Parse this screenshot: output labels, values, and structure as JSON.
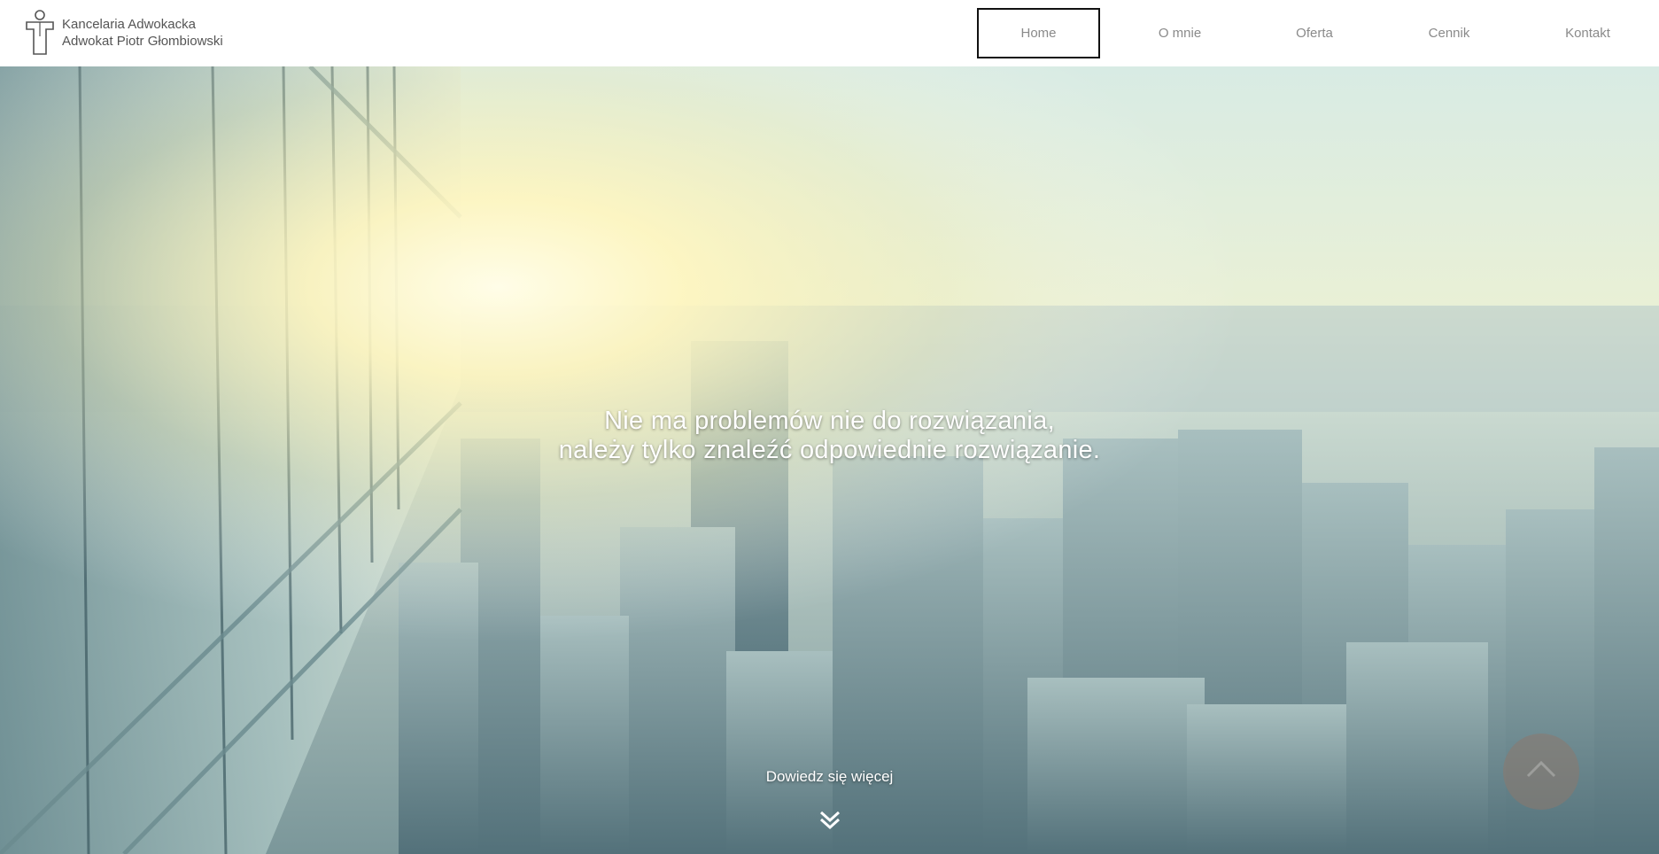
{
  "header": {
    "logo_line1": "Kancelaria Adwokacka",
    "logo_line2": "Adwokat Piotr Głombiowski",
    "logo_icon": "lawyer-figure-icon"
  },
  "nav": {
    "items": [
      {
        "label": "Home",
        "active": true
      },
      {
        "label": "O mnie",
        "active": false
      },
      {
        "label": "Oferta",
        "active": false
      },
      {
        "label": "Cennik",
        "active": false
      },
      {
        "label": "Kontakt",
        "active": false
      }
    ]
  },
  "hero": {
    "heading_line1": "Nie ma problemów nie do rozwiązania,",
    "heading_line2": "należy tylko znaleźć odpowiednie rozwiązanie.",
    "cta_label": "Dowiedz się więcej",
    "cta_icon": "double-chevron-down-icon",
    "scroll_top_icon": "scroll-to-top-icon",
    "background_description_colors": {
      "sky_top": "#dfeee6",
      "sun_glow": "#fff8c8",
      "city_mid": "#a9c2c0",
      "city_dark": "#5f7f86"
    }
  }
}
